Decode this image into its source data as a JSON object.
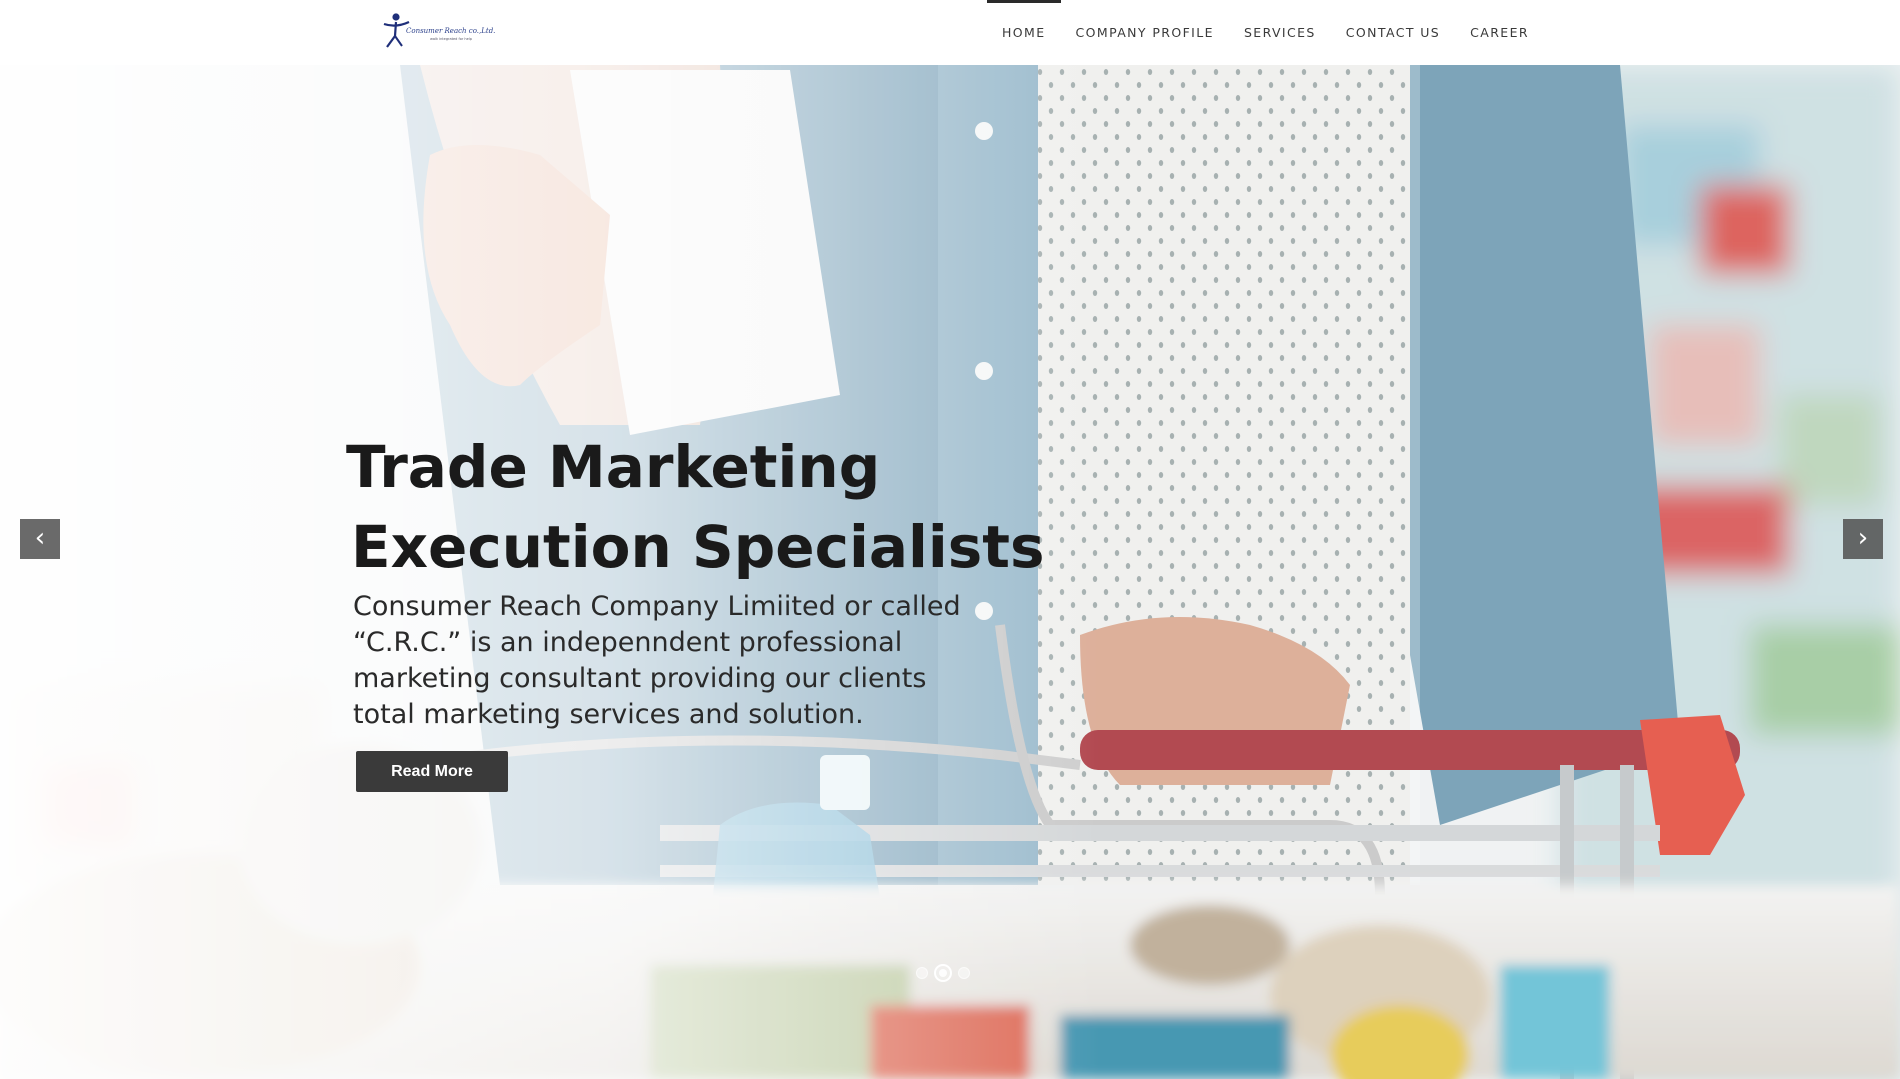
{
  "brand": {
    "logo_text": "Consumer Reach co.,Ltd.",
    "logo_tagline": "walk integrated for help"
  },
  "nav": {
    "items": [
      {
        "label": "HOME",
        "active": true
      },
      {
        "label": "COMPANY PROFILE",
        "active": false
      },
      {
        "label": "SERVICES",
        "active": false
      },
      {
        "label": "CONTACT US",
        "active": false
      },
      {
        "label": "CAREER",
        "active": false
      }
    ]
  },
  "hero": {
    "headline_line1": "Trade Marketing",
    "headline_line2": "Execution Specialists",
    "description_lines": [
      "Consumer Reach Company Limiited or called",
      "“C.R.C.” is an indepenndent professional",
      "marketing consultant providing our clients",
      "total marketing services and solution."
    ],
    "cta_label": "Read More",
    "prev_glyph": "‹",
    "next_glyph": "›",
    "slides_total": 3,
    "active_slide": 2
  },
  "colors": {
    "nav_text": "#3a3a3a",
    "button_bg": "#3a3a3a",
    "headline": "#1a1a1a"
  }
}
